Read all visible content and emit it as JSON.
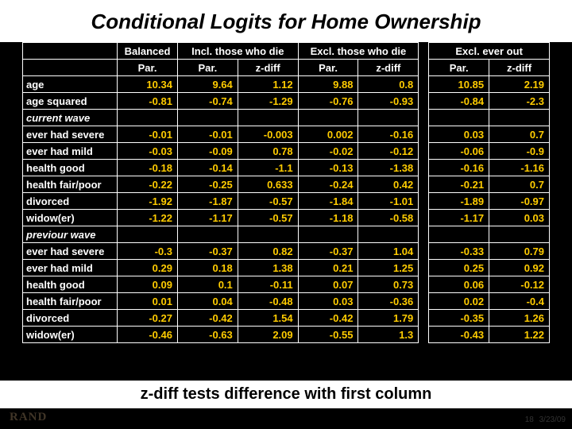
{
  "title": "Conditional Logits for Home Ownership",
  "caption": "z-diff tests difference with first column",
  "brand": "RAND",
  "page_num": "18",
  "date": "3/23/09",
  "head_groups": {
    "rowlabel_blank": "",
    "balanced": "Balanced",
    "incl_die": "Incl. those who die",
    "excl_die": "Excl. those who die",
    "excl_everout": "Excl. ever out"
  },
  "head_sub": {
    "par": "Par.",
    "zdiff": "z-diff"
  },
  "rows": [
    {
      "label": "age",
      "italic": false,
      "v": [
        "10.34",
        "9.64",
        "1.12",
        "9.88",
        "0.8",
        "10.85",
        "2.19"
      ]
    },
    {
      "label": "age squared",
      "italic": false,
      "v": [
        "-0.81",
        "-0.74",
        "-1.29",
        "-0.76",
        "-0.93",
        "-0.84",
        "-2.3"
      ]
    },
    {
      "label": "current wave",
      "italic": true,
      "v": [
        "",
        "",
        "",
        "",
        "",
        "",
        ""
      ]
    },
    {
      "label": "ever had severe",
      "italic": false,
      "v": [
        "-0.01",
        "-0.01",
        "-0.003",
        "0.002",
        "-0.16",
        "0.03",
        "0.7"
      ]
    },
    {
      "label": "ever had mild",
      "italic": false,
      "v": [
        "-0.03",
        "-0.09",
        "0.78",
        "-0.02",
        "-0.12",
        "-0.06",
        "-0.9"
      ]
    },
    {
      "label": "health good",
      "italic": false,
      "v": [
        "-0.18",
        "-0.14",
        "-1.1",
        "-0.13",
        "-1.38",
        "-0.16",
        "-1.16"
      ]
    },
    {
      "label": "health fair/poor",
      "italic": false,
      "v": [
        "-0.22",
        "-0.25",
        "0.633",
        "-0.24",
        "0.42",
        "-0.21",
        "0.7"
      ]
    },
    {
      "label": "divorced",
      "italic": false,
      "v": [
        "-1.92",
        "-1.87",
        "-0.57",
        "-1.84",
        "-1.01",
        "-1.89",
        "-0.97"
      ]
    },
    {
      "label": "widow(er)",
      "italic": false,
      "v": [
        "-1.22",
        "-1.17",
        "-0.57",
        "-1.18",
        "-0.58",
        "-1.17",
        "0.03"
      ]
    },
    {
      "label": "previour wave",
      "italic": true,
      "v": [
        "",
        "",
        "",
        "",
        "",
        "",
        ""
      ]
    },
    {
      "label": "ever had severe",
      "italic": false,
      "v": [
        "-0.3",
        "-0.37",
        "0.82",
        "-0.37",
        "1.04",
        "-0.33",
        "0.79"
      ]
    },
    {
      "label": "ever had mild",
      "italic": false,
      "v": [
        "0.29",
        "0.18",
        "1.38",
        "0.21",
        "1.25",
        "0.25",
        "0.92"
      ]
    },
    {
      "label": "health good",
      "italic": false,
      "v": [
        "0.09",
        "0.1",
        "-0.11",
        "0.07",
        "0.73",
        "0.06",
        "-0.12"
      ]
    },
    {
      "label": "health fair/poor",
      "italic": false,
      "v": [
        "0.01",
        "0.04",
        "-0.48",
        "0.03",
        "-0.36",
        "0.02",
        "-0.4"
      ]
    },
    {
      "label": "divorced",
      "italic": false,
      "v": [
        "-0.27",
        "-0.42",
        "1.54",
        "-0.42",
        "1.79",
        "-0.35",
        "1.26"
      ]
    },
    {
      "label": "widow(er)",
      "italic": false,
      "v": [
        "-0.46",
        "-0.63",
        "2.09",
        "-0.55",
        "1.3",
        "-0.43",
        "1.22"
      ]
    }
  ]
}
